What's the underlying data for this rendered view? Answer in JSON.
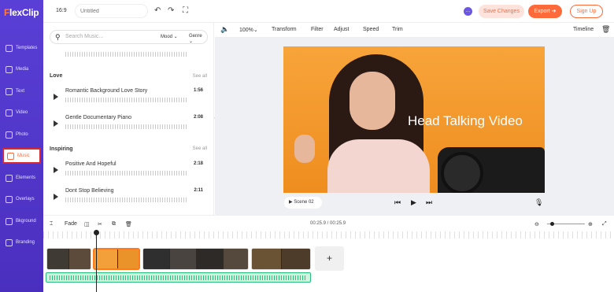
{
  "app": {
    "logo_f": "F",
    "logo_rest": "lexClip"
  },
  "sidebar": {
    "items": [
      {
        "label": "Templates",
        "icon": "templates-icon"
      },
      {
        "label": "Media",
        "icon": "media-icon"
      },
      {
        "label": "Text",
        "icon": "text-icon"
      },
      {
        "label": "Video",
        "icon": "video-icon"
      },
      {
        "label": "Photo",
        "icon": "photo-icon"
      },
      {
        "label": "Music",
        "icon": "music-icon",
        "active": true
      },
      {
        "label": "Elements",
        "icon": "elements-icon"
      },
      {
        "label": "Overlays",
        "icon": "overlays-icon"
      },
      {
        "label": "Bkground",
        "icon": "background-icon"
      },
      {
        "label": "Branding",
        "icon": "branding-icon"
      }
    ]
  },
  "topbar": {
    "ratio": "16:9",
    "title_placeholder": "Untitled",
    "save_label": "Save Changes",
    "export_label": "Export ➔",
    "signup_label": "Sign Up"
  },
  "music": {
    "search_placeholder": "Search Music...",
    "mood_label": "Mood ⌄",
    "genre_label": "Genre ⌄",
    "sections": [
      {
        "title": "Love",
        "see_all": "See all",
        "tracks": [
          {
            "name": "Romantic Background Love Story",
            "duration": "1:56"
          },
          {
            "name": "Gentle Documentary Piano",
            "duration": "2:08"
          }
        ]
      },
      {
        "title": "Inspiring",
        "see_all": "See all",
        "tracks": [
          {
            "name": "Positive And Hopeful",
            "duration": "2:18"
          },
          {
            "name": "Dont Stop Believing",
            "duration": "2:11"
          }
        ]
      }
    ]
  },
  "edit_toolbar": {
    "zoom": "100%⌄",
    "transform": "Transform",
    "filter": "Filter",
    "adjust": "Adjust",
    "speed": "Speed",
    "trim": "Trim",
    "timeline": "Timeline"
  },
  "preview": {
    "overlay_text": "Head Talking Video",
    "scene_label": "Scene 02"
  },
  "timeline": {
    "fade": "Fade",
    "time": "00:25.9 / 00:25.9",
    "add": "+"
  },
  "colors": {
    "accent": "#ff6a3a",
    "sidebar": "#5a3fd6",
    "audio": "#27c07a"
  }
}
